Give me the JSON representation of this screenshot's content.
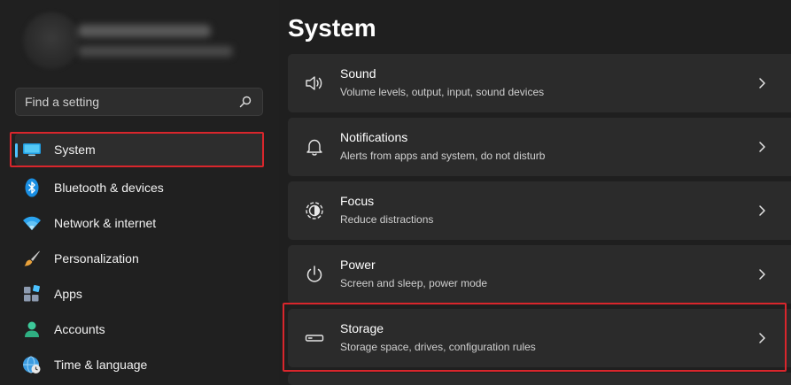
{
  "sidebar": {
    "search": {
      "placeholder": "Find a setting"
    },
    "items": [
      {
        "label": "System",
        "icon": "system-monitor-icon",
        "selected": true
      },
      {
        "label": "Bluetooth & devices",
        "icon": "bluetooth-icon"
      },
      {
        "label": "Network & internet",
        "icon": "wifi-icon"
      },
      {
        "label": "Personalization",
        "icon": "paintbrush-icon"
      },
      {
        "label": "Apps",
        "icon": "apps-icon"
      },
      {
        "label": "Accounts",
        "icon": "person-icon"
      },
      {
        "label": "Time & language",
        "icon": "globe-clock-icon"
      }
    ]
  },
  "main": {
    "title": "System",
    "cards": [
      {
        "title": "Sound",
        "subtitle": "Volume levels, output, input, sound devices",
        "icon": "speaker-icon"
      },
      {
        "title": "Notifications",
        "subtitle": "Alerts from apps and system, do not disturb",
        "icon": "bell-icon"
      },
      {
        "title": "Focus",
        "subtitle": "Reduce distractions",
        "icon": "focus-icon"
      },
      {
        "title": "Power",
        "subtitle": "Screen and sleep, power mode",
        "icon": "power-icon"
      },
      {
        "title": "Storage",
        "subtitle": "Storage space, drives, configuration rules",
        "icon": "storage-drive-icon"
      }
    ]
  },
  "colors": {
    "accent": "#4cc2ff",
    "highlight": "#d9262c",
    "card": "#2b2b2b",
    "background": "#1f1f1f"
  }
}
